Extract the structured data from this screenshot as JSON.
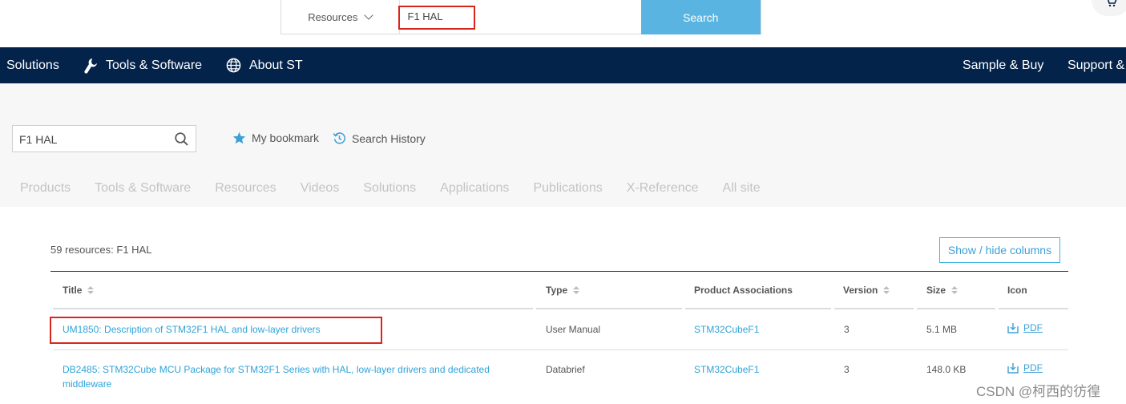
{
  "top_search": {
    "scope_label": "Resources",
    "query": "F1 HAL",
    "search_label": "Search"
  },
  "nav": {
    "left": [
      "Solutions",
      "Tools & Software",
      "About ST"
    ],
    "right": [
      "Sample & Buy",
      "Support &"
    ]
  },
  "panel": {
    "search_value": "F1 HAL",
    "bookmark_label": "My bookmark",
    "history_label": "Search History",
    "tabs": [
      "Products",
      "Tools & Software",
      "Resources",
      "Videos",
      "Solutions",
      "Applications",
      "Publications",
      "X-Reference",
      "All site"
    ]
  },
  "results": {
    "count_text": "59 resources: F1 HAL",
    "show_hide_label": "Show / hide columns",
    "columns": [
      "Title",
      "Type",
      "Product Associations",
      "Version",
      "Size",
      "Icon"
    ],
    "rows": [
      {
        "title": "UM1850: Description of STM32F1 HAL and low-layer drivers",
        "type": "User Manual",
        "product": "STM32CubeF1",
        "version": "3",
        "size": "5.1 MB",
        "icon": "PDF"
      },
      {
        "title": "DB2485: STM32Cube MCU Package for STM32F1 Series with HAL, low-layer drivers and dedicated middleware",
        "type": "Databrief",
        "product": "STM32CubeF1",
        "version": "3",
        "size": "148.0 KB",
        "icon": "PDF"
      }
    ]
  },
  "watermark": "CSDN @柯西的彷徨",
  "colors": {
    "nav_bg": "#03234b",
    "accent": "#3cb4e5",
    "search_button": "#5ab4e1",
    "highlight": "#d9261c"
  },
  "icons": [
    "chevron-down-icon",
    "cart-icon",
    "wrench-icon",
    "globe-icon",
    "search-icon",
    "star-icon",
    "history-icon",
    "sort-icon",
    "download-icon"
  ]
}
